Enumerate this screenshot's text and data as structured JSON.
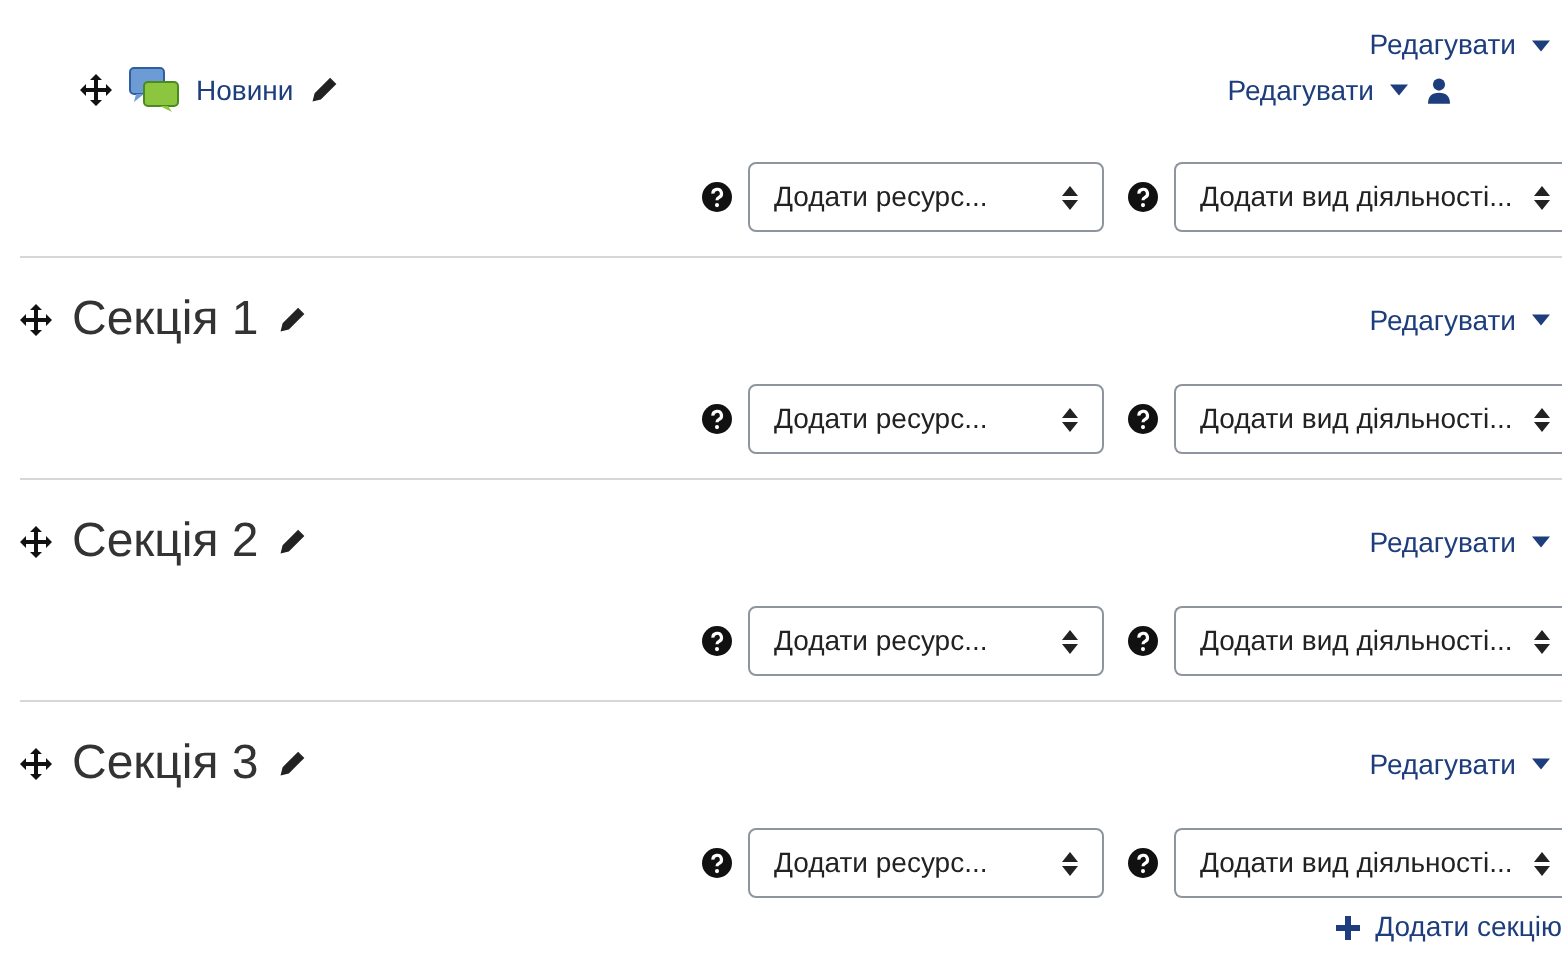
{
  "sections": [
    {
      "edit_label": "Редагувати",
      "activities": [
        {
          "name": "Новини",
          "edit_label": "Редагувати"
        }
      ],
      "resource_select": "Додати ресурс...",
      "activity_select": "Додати вид діяльності..."
    },
    {
      "title": "Секція 1",
      "edit_label": "Редагувати",
      "resource_select": "Додати ресурс...",
      "activity_select": "Додати вид діяльності..."
    },
    {
      "title": "Секція 2",
      "edit_label": "Редагувати",
      "resource_select": "Додати ресурс...",
      "activity_select": "Додати вид діяльності..."
    },
    {
      "title": "Секція 3",
      "edit_label": "Редагувати",
      "resource_select": "Додати ресурс...",
      "activity_select": "Додати вид діяльності..."
    }
  ],
  "add_section": "Додати секцію"
}
